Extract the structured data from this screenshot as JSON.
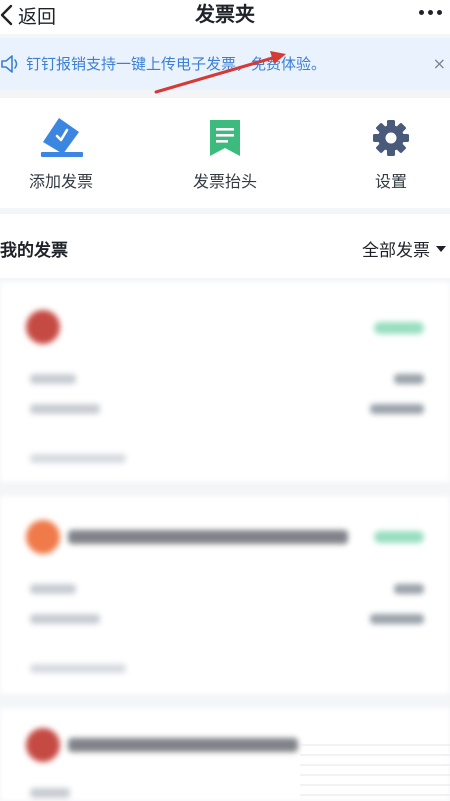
{
  "navbar": {
    "back_label": "返回",
    "title": "发票夹"
  },
  "banner": {
    "text": "钉钉报销支持一键上传电子发票，免费体验。",
    "close": "×"
  },
  "actions": [
    {
      "label": "添加发票",
      "icon": "add-invoice-icon",
      "color": "#3b86e0"
    },
    {
      "label": "发票抬头",
      "icon": "invoice-title-icon",
      "color": "#3dba7e"
    },
    {
      "label": "设置",
      "icon": "gear-icon",
      "color": "#4a5a7a"
    }
  ],
  "section": {
    "title": "我的发票",
    "filter_label": "全部发票"
  },
  "colors": {
    "accent": "#3b7fd6",
    "arrow": "#d63a35",
    "status_green": "#6bd0a6"
  }
}
